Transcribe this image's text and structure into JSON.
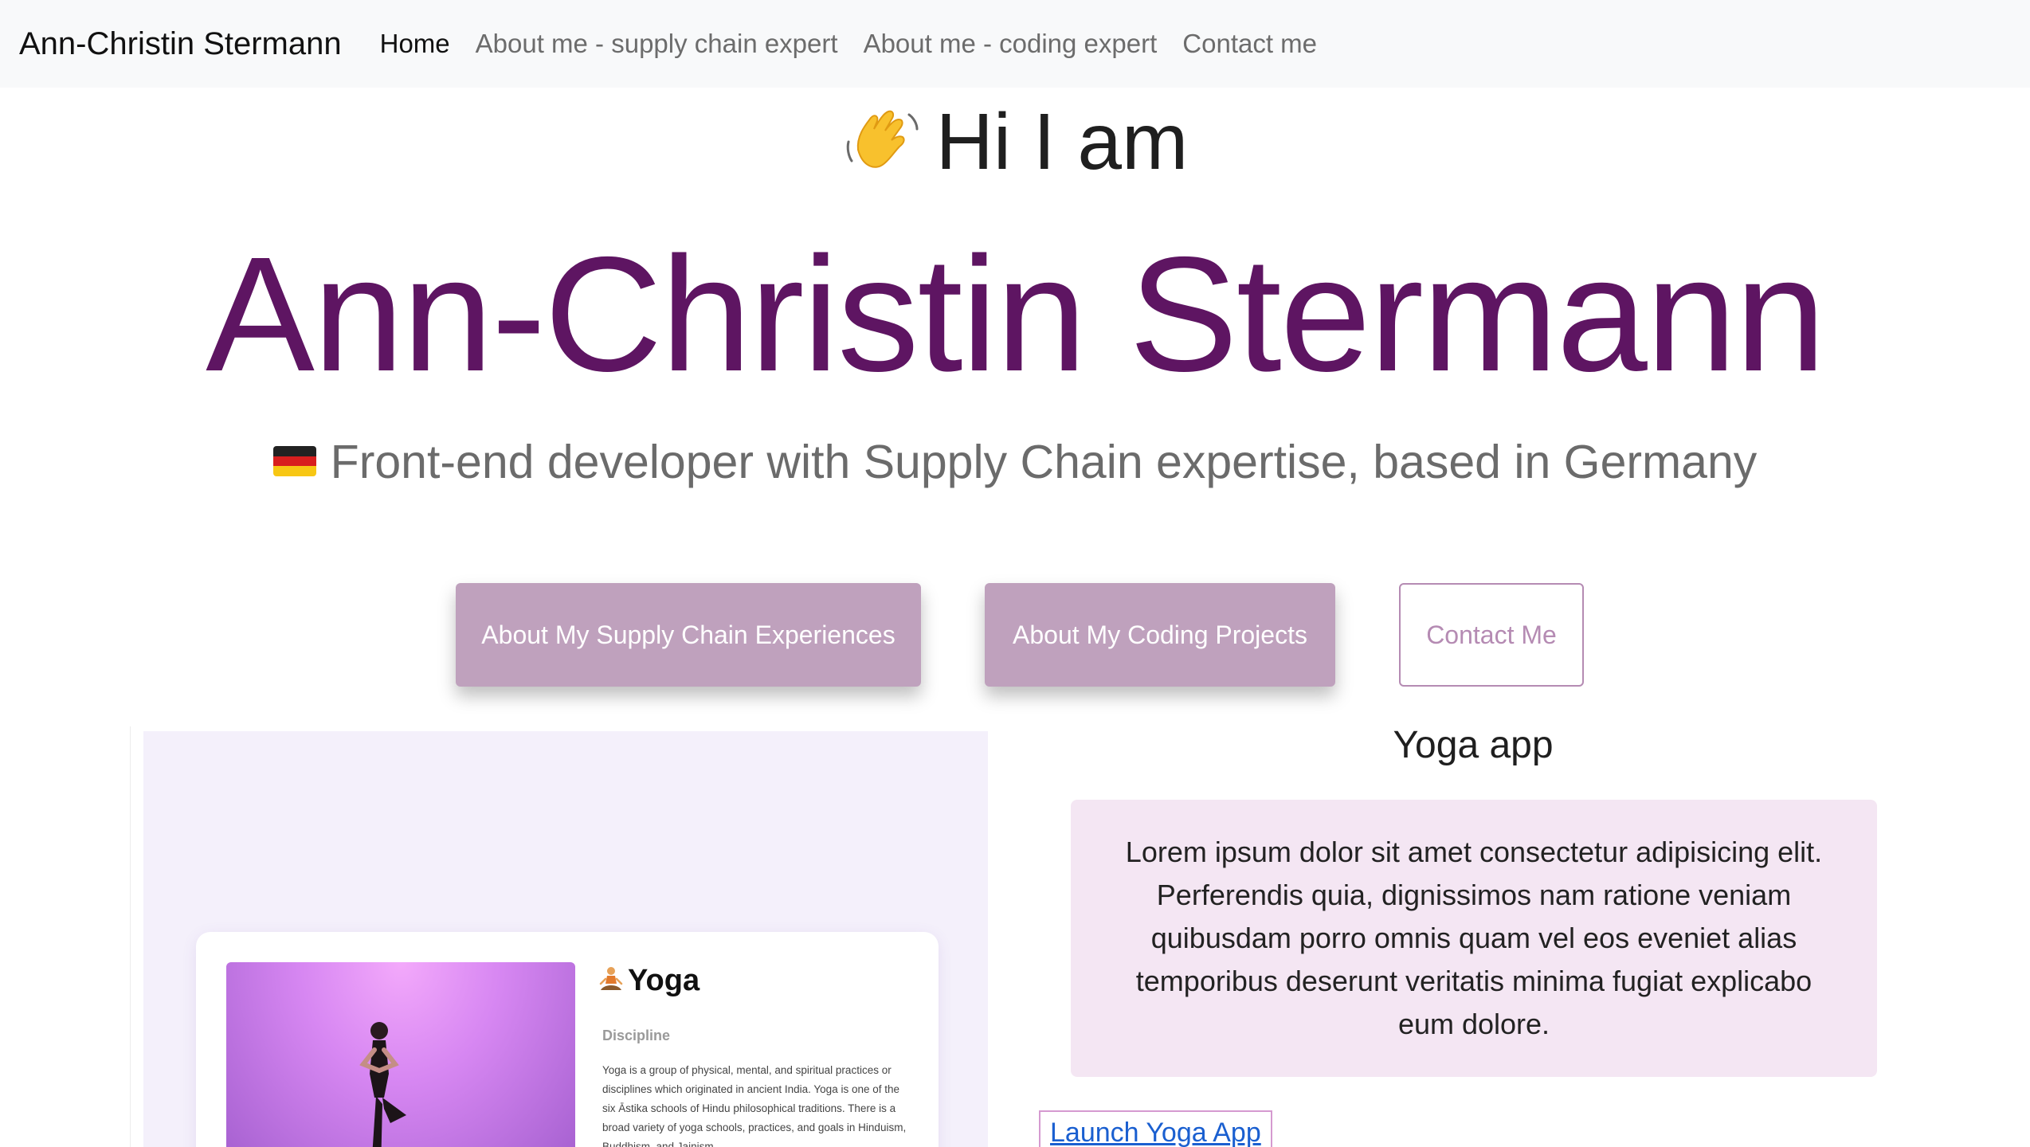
{
  "nav": {
    "brand": "Ann-Christin Stermann",
    "links": [
      {
        "label": "Home",
        "active": true
      },
      {
        "label": "About me - supply chain expert",
        "active": false
      },
      {
        "label": "About me - coding expert",
        "active": false
      },
      {
        "label": "Contact me",
        "active": false
      }
    ]
  },
  "hero": {
    "greeting_icon": "waving-hand-icon",
    "greeting": "Hi I am",
    "name": "Ann-Christin Stermann",
    "flag_icon": "germany-flag-icon",
    "subtitle": "Front-end developer with Supply Chain expertise, based in Germany"
  },
  "buttons": {
    "supply_chain": "About My Supply Chain Experiences",
    "coding": "About My Coding Projects",
    "contact": "Contact Me"
  },
  "preview": {
    "icon": "lotus-position-icon",
    "title": "Yoga",
    "label": "Discipline",
    "description": "Yoga is a group of physical, mental, and spiritual practices or disciplines which originated in ancient India. Yoga is one of the six Āstika schools of Hindu philosophical traditions. There is a broad variety of yoga schools, practices, and goals in Hinduism, Buddhism, and Jainism."
  },
  "project": {
    "title": "Yoga app",
    "description": "Lorem ipsum dolor sit amet consectetur adipisicing elit. Perferendis quia, dignissimos nam ratione veniam quibusdam porro omnis quam vel eos eveniet alias temporibus deserunt veritatis minima fugiat explicabo eum dolore.",
    "launch_label": "Launch Yoga App"
  },
  "colors": {
    "accent": "#5e1562",
    "button_fill": "#bfa1bd",
    "button_outline": "#b58bb3",
    "lorem_bg": "#f4e6f3",
    "link": "#1a5fd0"
  }
}
